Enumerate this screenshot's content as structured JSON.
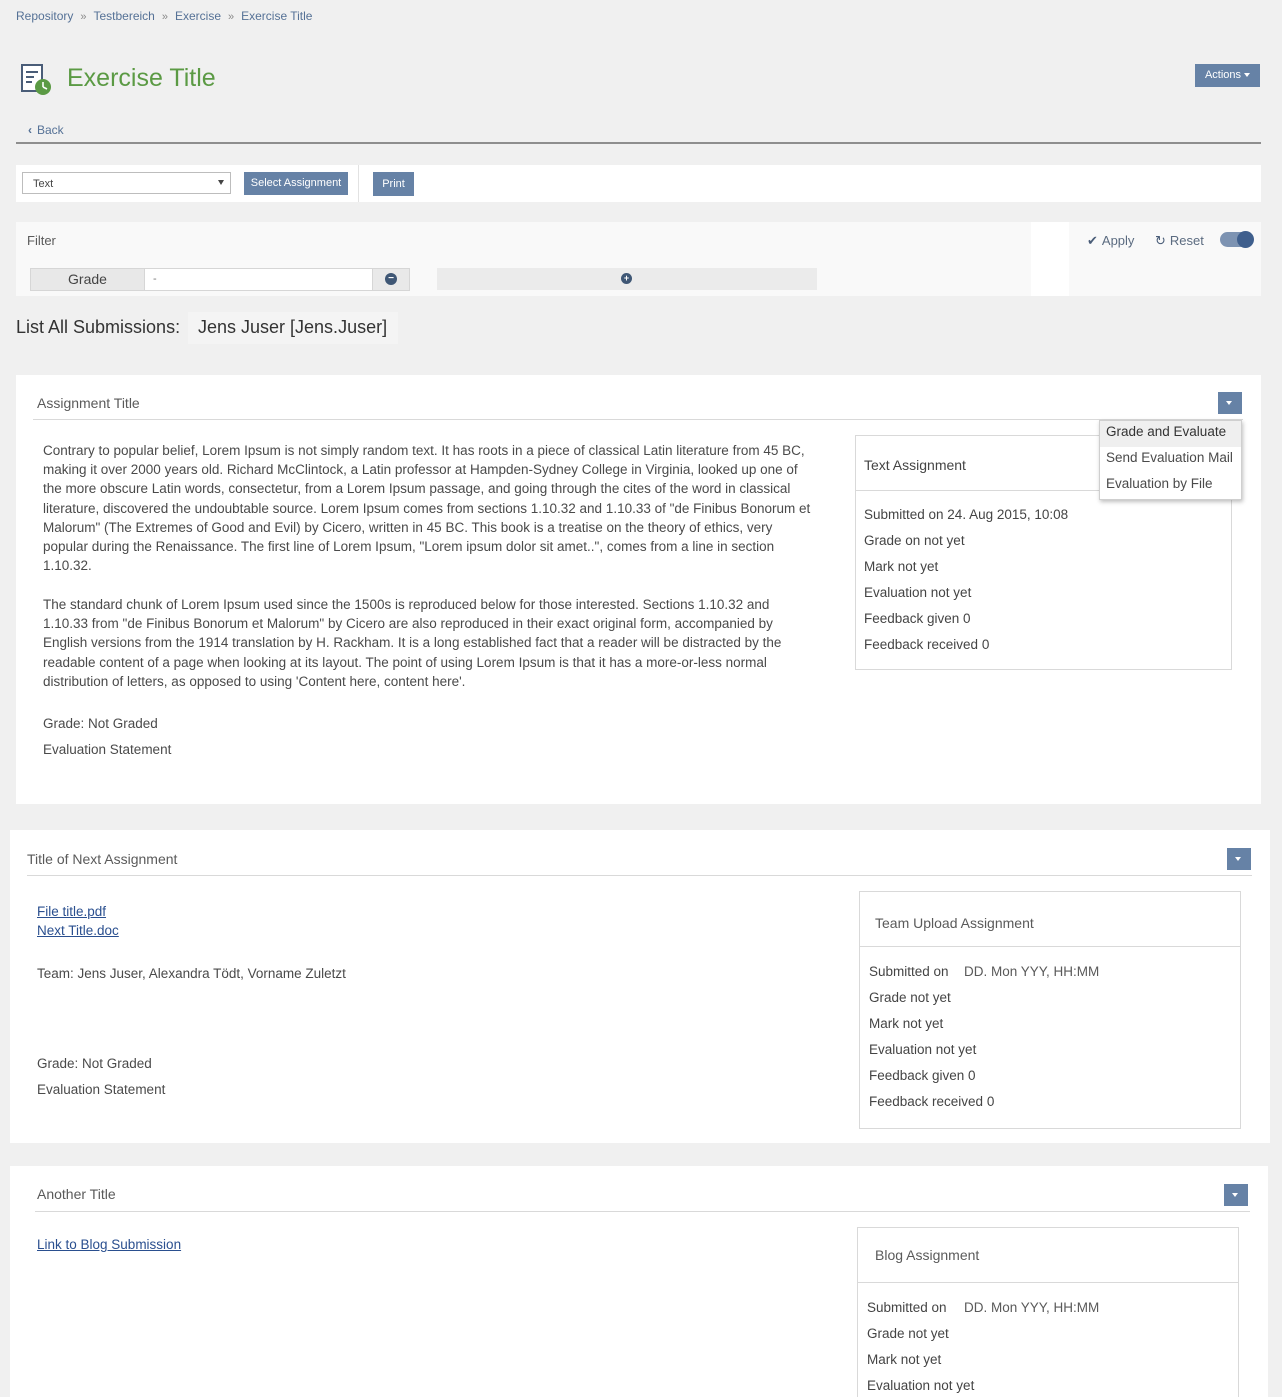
{
  "breadcrumb": [
    "Repository",
    "Testbereich",
    "Exercise",
    "Exercise Title"
  ],
  "breadcrumb_sep": "»",
  "page_title": "Exercise Title",
  "actions_label": "Actions",
  "back_label": "Back",
  "toolbar": {
    "select_value": "Text",
    "select_assignment_label": "Select Assignment",
    "print_label": "Print"
  },
  "filter": {
    "label": "Filter",
    "apply_label": "Apply",
    "reset_label": "Reset",
    "toggle_on": true,
    "grade_label": "Grade",
    "grade_value": "-"
  },
  "list": {
    "label": "List All Submissions:",
    "user": "Jens Juser [Jens.Juser]"
  },
  "cards": [
    {
      "title": "Assignment Title",
      "paragraphs": [
        "Contrary to popular belief, Lorem Ipsum is not simply random text. It has roots in a piece of classical Latin literature from 45 BC, making it over 2000 years old. Richard McClintock, a Latin professor at Hampden-Sydney College in Virginia, looked up one of the more obscure Latin words, consectetur, from a Lorem Ipsum passage, and going through the cites of the word in classical literature, discovered the undoubtable source. Lorem Ipsum comes from sections 1.10.32 and 1.10.33 of \"de Finibus Bonorum et Malorum\" (The Extremes of Good and Evil) by Cicero, written in 45 BC. This book is a treatise on the theory of ethics, very popular during the Renaissance. The first line of Lorem Ipsum, \"Lorem ipsum dolor sit amet..\", comes from a line in section 1.10.32.",
        "The standard chunk of Lorem Ipsum used since the 1500s is reproduced below for those interested. Sections 1.10.32 and 1.10.33 from \"de Finibus Bonorum et Malorum\" by Cicero are also reproduced in their exact original form, accompanied by English versions from the 1914 translation by H. Rackham. It is a long established fact that a reader will be distracted by the readable content of a page when looking at its layout. The point of using Lorem Ipsum is that it has a more-or-less normal distribution of letters, as opposed to using 'Content here, content here'."
      ],
      "grade": "Grade: Not Graded",
      "evaluation": "Evaluation Statement",
      "info": {
        "title": "Text Assignment",
        "submitted": "Submitted on 24. Aug 2015, 10:08",
        "grade": "Grade on not yet",
        "mark": "Mark not yet",
        "evaluation": "Evaluation not yet",
        "feedback_given": "Feedback given 0",
        "feedback_received": "Feedback received 0"
      },
      "menu": [
        "Grade and Evaluate",
        "Send Evaluation Mail",
        "Evaluation by File"
      ]
    },
    {
      "title": "Title of Next Assignment",
      "files": [
        "File title.pdf",
        "Next Title.doc"
      ],
      "team": "Team: Jens Juser, Alexandra Tödt, Vorname Zuletzt",
      "grade": "Grade: Not Graded",
      "evaluation": "Evaluation Statement",
      "info": {
        "title": "Team Upload Assignment",
        "submitted_label": "Submitted on",
        "submitted_value": "DD. Mon YYY, HH:MM",
        "grade": "Grade not yet",
        "mark": "Mark not yet",
        "evaluation": "Evaluation not yet",
        "feedback_given": "Feedback given 0",
        "feedback_received": "Feedback received 0"
      }
    },
    {
      "title": "Another Title",
      "link": "Link to Blog Submission",
      "info": {
        "title": "Blog Assignment",
        "submitted_label": "Submitted on",
        "submitted_value": "DD. Mon YYY, HH:MM",
        "grade": "Grade not yet",
        "mark": "Mark not yet",
        "evaluation": "Evaluation not yet"
      }
    }
  ],
  "colors": {
    "title_green": "#5b9a44",
    "button_blue": "#6682a6",
    "link_blue": "#2a4f8f"
  }
}
